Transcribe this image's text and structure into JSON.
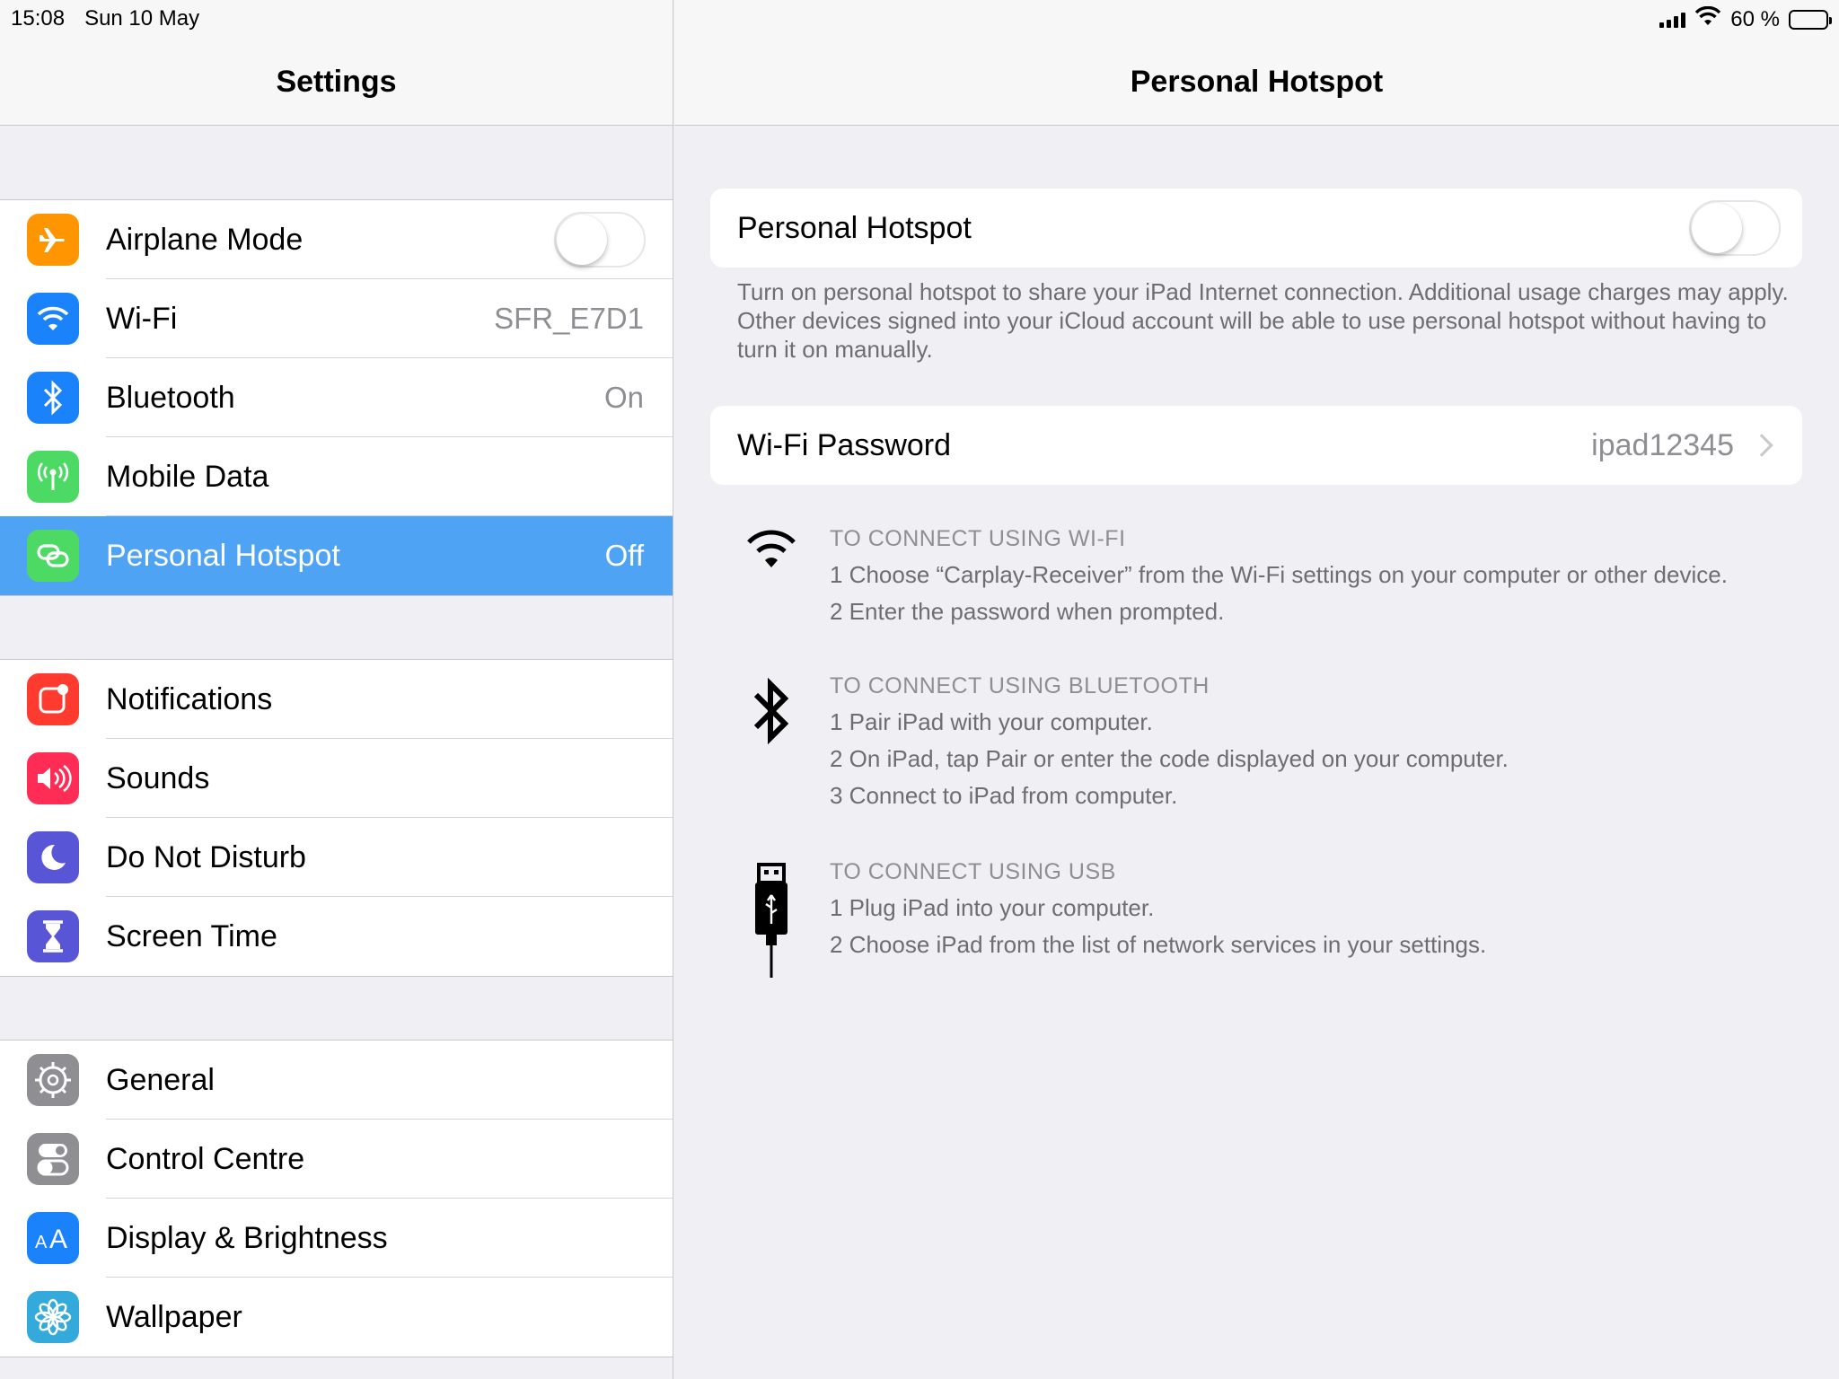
{
  "status_bar": {
    "time": "15:08",
    "date": "Sun 10 May",
    "battery_text": "60 %",
    "battery_level": 0.6,
    "icons": [
      "cellular-signal-icon",
      "wifi-icon",
      "battery-icon"
    ]
  },
  "master": {
    "title": "Settings",
    "groups": [
      [
        {
          "label": "Airplane Mode",
          "icon": "airplane-icon",
          "color": "#ff9500",
          "toggle": false
        },
        {
          "label": "Wi-Fi",
          "icon": "wifi-icon",
          "color": "#1a82fb",
          "value": "SFR_E7D1"
        },
        {
          "label": "Bluetooth",
          "icon": "bluetooth-icon",
          "color": "#1a82fb",
          "value": "On"
        },
        {
          "label": "Mobile Data",
          "icon": "antenna-icon",
          "color": "#4cd964"
        },
        {
          "label": "Personal Hotspot",
          "icon": "hotspot-icon",
          "color": "#4cd964",
          "value": "Off",
          "selected": true
        }
      ],
      [
        {
          "label": "Notifications",
          "icon": "notifications-icon",
          "color": "#ff3b30"
        },
        {
          "label": "Sounds",
          "icon": "speaker-icon",
          "color": "#ff2d55"
        },
        {
          "label": "Do Not Disturb",
          "icon": "moon-icon",
          "color": "#5856d6"
        },
        {
          "label": "Screen Time",
          "icon": "hourglass-icon",
          "color": "#5856d6"
        }
      ],
      [
        {
          "label": "General",
          "icon": "gear-icon",
          "color": "#8e8e93"
        },
        {
          "label": "Control Centre",
          "icon": "switches-icon",
          "color": "#8e8e93"
        },
        {
          "label": "Display & Brightness",
          "icon": "text-size-icon",
          "color": "#1a82fb"
        },
        {
          "label": "Wallpaper",
          "icon": "flower-icon",
          "color": "#34aadc"
        }
      ]
    ]
  },
  "detail": {
    "title": "Personal Hotspot",
    "hotspot_toggle": {
      "label": "Personal Hotspot",
      "on": false
    },
    "hotspot_footer": "Turn on personal hotspot to share your iPad Internet connection. Additional usage charges may apply. Other devices signed into your iCloud account will be able to use personal hotspot without having to turn it on manually.",
    "wifi_password": {
      "label": "Wi-Fi Password",
      "value": "ipad12345"
    },
    "connect": [
      {
        "icon": "wifi-icon",
        "heading": "TO CONNECT USING WI-FI",
        "steps": [
          "1 Choose “Carplay-Receiver” from the Wi-Fi settings on your computer or other device.",
          "2 Enter the password when prompted."
        ]
      },
      {
        "icon": "bluetooth-icon",
        "heading": "TO CONNECT USING BLUETOOTH",
        "steps": [
          "1 Pair iPad with your computer.",
          "2 On iPad, tap Pair or enter the code displayed on your computer.",
          "3 Connect to iPad from computer."
        ]
      },
      {
        "icon": "usb-cable-icon",
        "heading": "TO CONNECT USING USB",
        "steps": [
          "1 Plug iPad into your computer.",
          "2 Choose iPad from the list of network services in your settings."
        ]
      }
    ]
  }
}
